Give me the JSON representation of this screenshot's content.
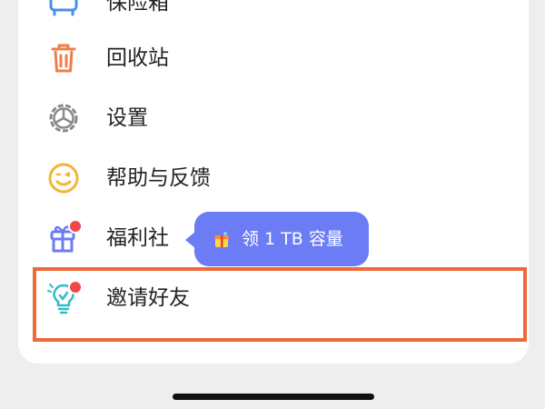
{
  "menu": {
    "items": [
      {
        "label": "保险箱",
        "icon": "safe-box-icon"
      },
      {
        "label": "回收站",
        "icon": "trash-icon"
      },
      {
        "label": "设置",
        "icon": "gear-icon"
      },
      {
        "label": "帮助与反馈",
        "icon": "smiley-icon"
      },
      {
        "label": "福利社",
        "icon": "gift-icon"
      },
      {
        "label": "邀请好友",
        "icon": "lightbulb-icon"
      }
    ]
  },
  "tooltip": {
    "text": "领 1 TB 容量"
  },
  "colors": {
    "accent": "#6b7cf5",
    "badge": "#f0484b",
    "highlight": "#ef6a3a"
  }
}
